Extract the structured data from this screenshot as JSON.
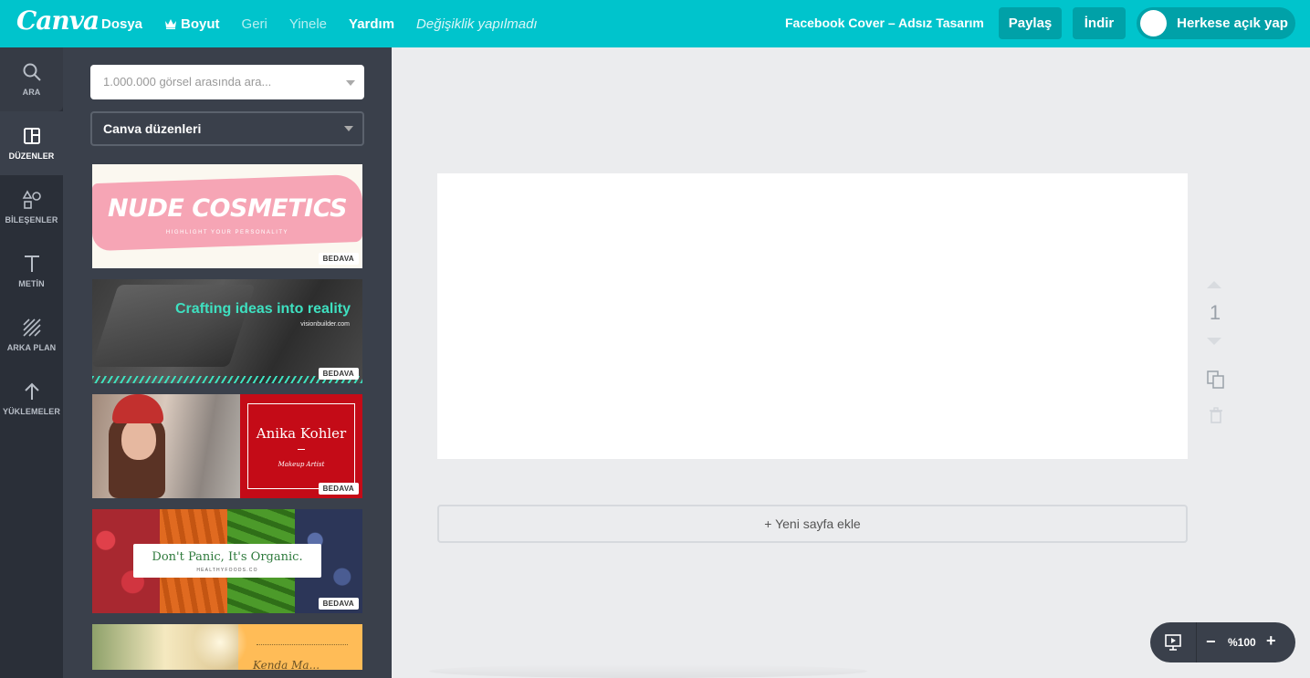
{
  "app": {
    "logo": "Canva"
  },
  "topbar": {
    "menu": [
      {
        "label": "Dosya"
      },
      {
        "label": "Boyut"
      },
      {
        "label": "Geri"
      },
      {
        "label": "Yinele"
      },
      {
        "label": "Yardım"
      }
    ],
    "status": "Değişiklik yapılmadı",
    "doc_title": "Facebook Cover – Adsız Tasarım",
    "share_label": "Paylaş",
    "download_label": "İndir",
    "public_label": "Herkese açık yap"
  },
  "rail": {
    "items": [
      {
        "label": "ARA",
        "icon": "search-icon"
      },
      {
        "label": "DÜZENLER",
        "icon": "layouts-icon"
      },
      {
        "label": "BİLEŞENLER",
        "icon": "elements-icon"
      },
      {
        "label": "METİN",
        "icon": "text-icon"
      },
      {
        "label": "ARKA PLAN",
        "icon": "background-icon"
      },
      {
        "label": "YÜKLEMELER",
        "icon": "upload-icon"
      }
    ],
    "active": "DÜZENLER"
  },
  "panel": {
    "search_placeholder": "1.000.000 görsel arasında ara...",
    "layout_select": "Canva düzenleri",
    "templates": [
      {
        "title": "NUDE COSMETICS",
        "subtitle": "HIGHLIGHT YOUR PERSONALITY",
        "badge": "BEDAVA"
      },
      {
        "title": "Crafting ideas into reality",
        "subtitle": "visionbuilder.com",
        "badge": "BEDAVA"
      },
      {
        "title": "Anika Kohler",
        "subtitle": "Makeup Artist",
        "badge": "BEDAVA"
      },
      {
        "title": "Don't Panic, It's Organic.",
        "subtitle": "HEALTHYFOODS.CO",
        "badge": "BEDAVA"
      },
      {
        "title": "Kenda Ma..."
      }
    ]
  },
  "editor": {
    "page_number": "1",
    "add_page_label": "+ Yeni sayfa ekle"
  },
  "zoom": {
    "value": "%100",
    "minus": "−",
    "plus": "+"
  },
  "colors": {
    "brand": "#00c4cc",
    "topbar_button": "#00a1a8",
    "rail_bg": "#2a2f38",
    "panel_bg": "#3a404b",
    "workspace_bg": "#ebecee"
  }
}
